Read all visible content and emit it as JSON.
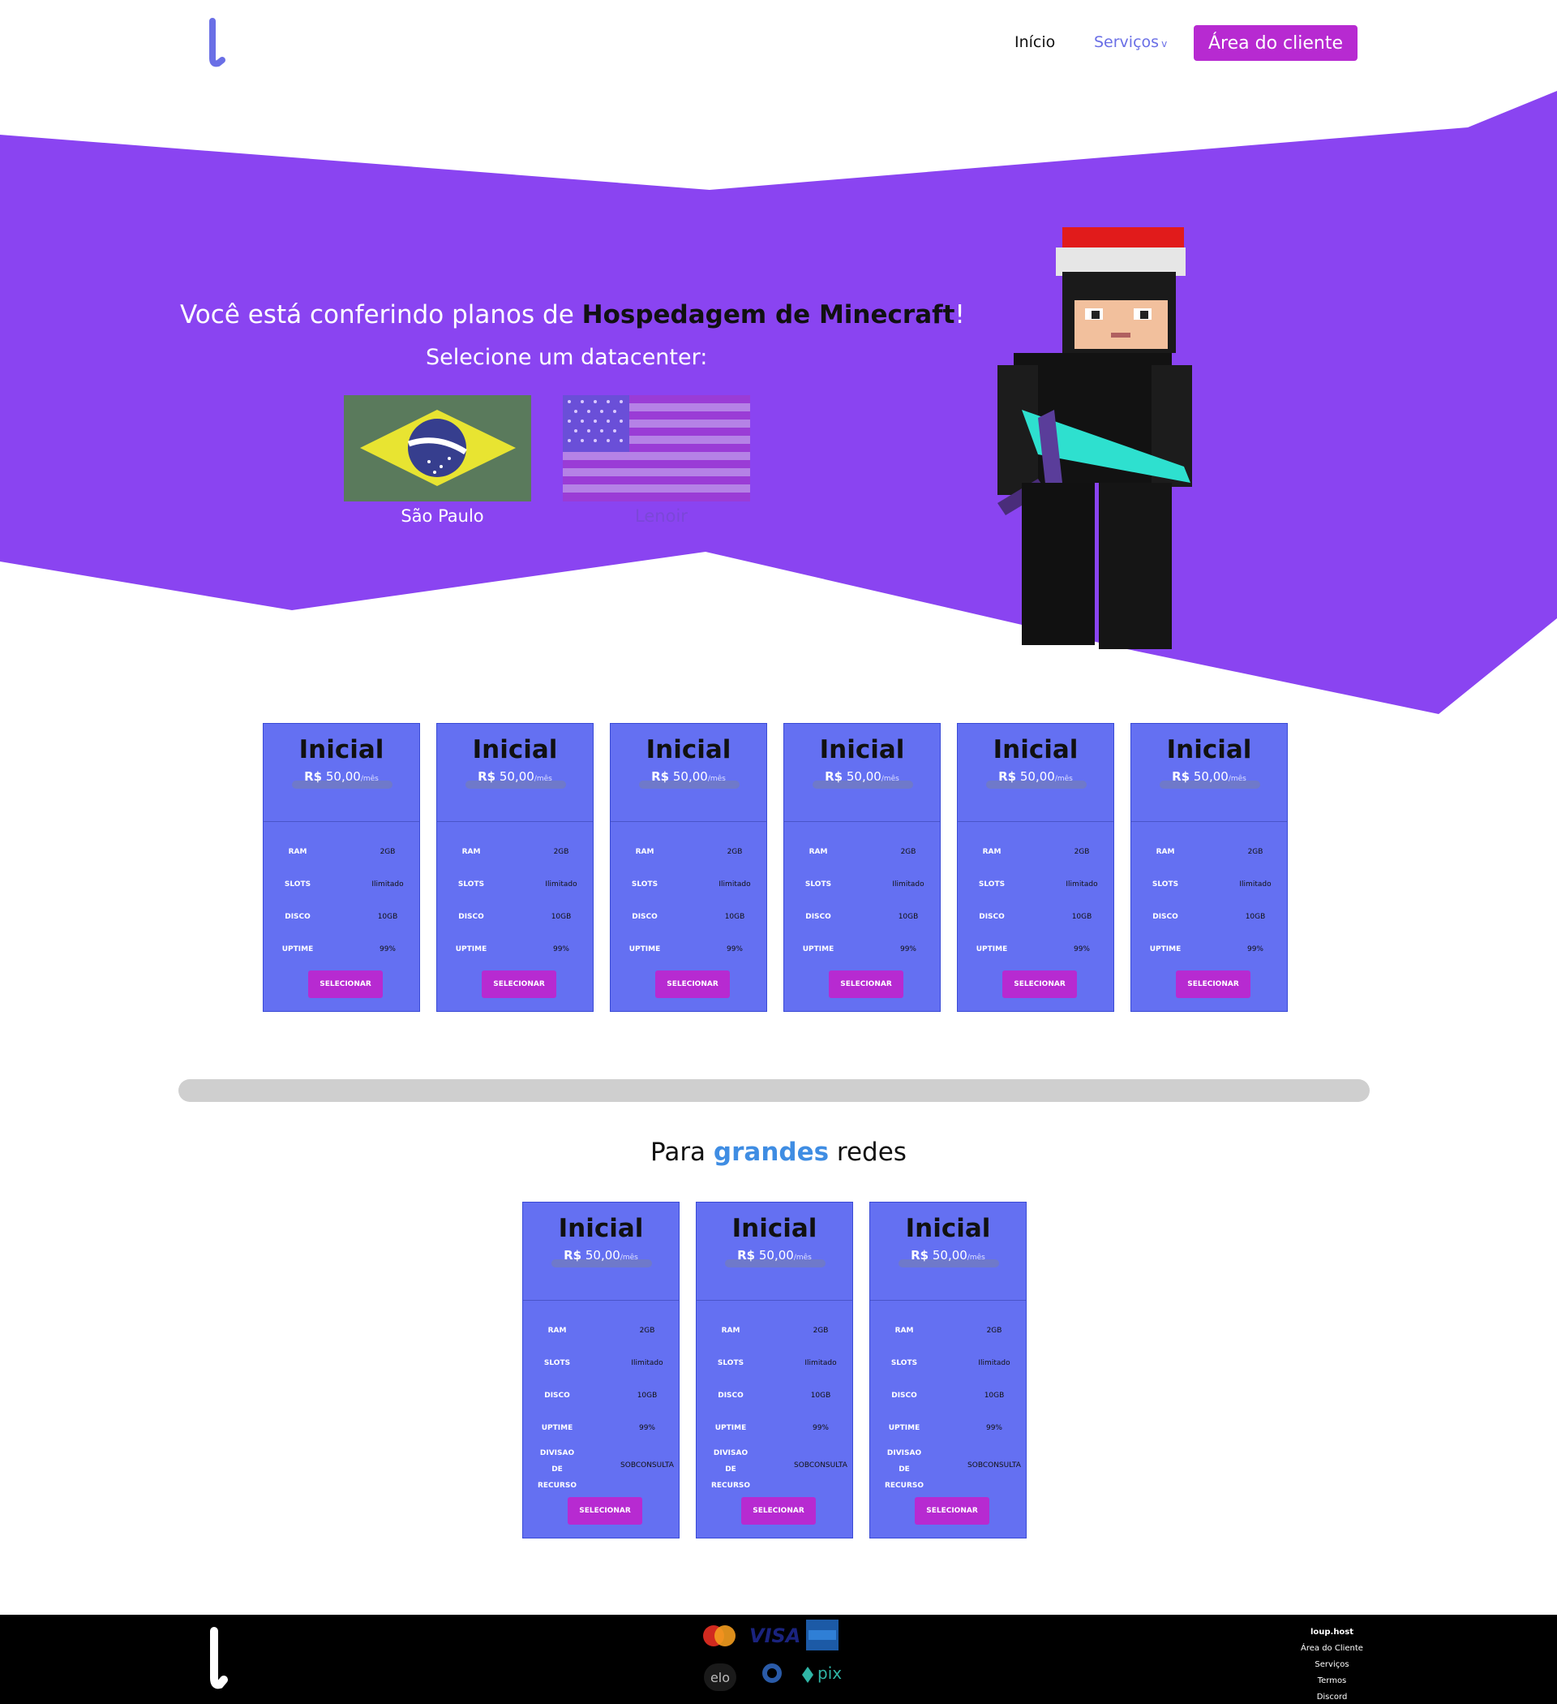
{
  "header": {
    "nav": {
      "inicio": "Início",
      "servicos": "Serviços",
      "caret": "v"
    },
    "client_button": "Área do cliente"
  },
  "hero": {
    "title_prefix": "Você está conferindo planos de ",
    "title_highlight": "Hospedagem de Minecraft",
    "title_suffix": "!",
    "subtitle": "Selecione um datacenter:",
    "datacenters": [
      {
        "label": "São Paulo"
      },
      {
        "label": "Lenoir"
      }
    ],
    "colors": {
      "purple": "#8a44f1",
      "button": "#b72ad1",
      "card": "#6470f2"
    }
  },
  "plans": [
    {
      "title": "Inicial",
      "currency": "R$",
      "price": " 50,00",
      "per": "/mês",
      "specs": [
        [
          "RAM",
          "2GB"
        ],
        [
          "SLOTS",
          "Ilimitado"
        ],
        [
          "DISCO",
          "10GB"
        ],
        [
          "UPTIME",
          "99%"
        ]
      ],
      "button": "SELECIONAR"
    },
    {
      "title": "Inicial",
      "currency": "R$",
      "price": " 50,00",
      "per": "/mês",
      "specs": [
        [
          "RAM",
          "2GB"
        ],
        [
          "SLOTS",
          "Ilimitado"
        ],
        [
          "DISCO",
          "10GB"
        ],
        [
          "UPTIME",
          "99%"
        ]
      ],
      "button": "SELECIONAR"
    },
    {
      "title": "Inicial",
      "currency": "R$",
      "price": " 50,00",
      "per": "/mês",
      "specs": [
        [
          "RAM",
          "2GB"
        ],
        [
          "SLOTS",
          "Ilimitado"
        ],
        [
          "DISCO",
          "10GB"
        ],
        [
          "UPTIME",
          "99%"
        ]
      ],
      "button": "SELECIONAR"
    },
    {
      "title": "Inicial",
      "currency": "R$",
      "price": " 50,00",
      "per": "/mês",
      "specs": [
        [
          "RAM",
          "2GB"
        ],
        [
          "SLOTS",
          "Ilimitado"
        ],
        [
          "DISCO",
          "10GB"
        ],
        [
          "UPTIME",
          "99%"
        ]
      ],
      "button": "SELECIONAR"
    },
    {
      "title": "Inicial",
      "currency": "R$",
      "price": " 50,00",
      "per": "/mês",
      "specs": [
        [
          "RAM",
          "2GB"
        ],
        [
          "SLOTS",
          "Ilimitado"
        ],
        [
          "DISCO",
          "10GB"
        ],
        [
          "UPTIME",
          "99%"
        ]
      ],
      "button": "SELECIONAR"
    },
    {
      "title": "Inicial",
      "currency": "R$",
      "price": " 50,00",
      "per": "/mês",
      "specs": [
        [
          "RAM",
          "2GB"
        ],
        [
          "SLOTS",
          "Ilimitado"
        ],
        [
          "DISCO",
          "10GB"
        ],
        [
          "UPTIME",
          "99%"
        ]
      ],
      "button": "SELECIONAR"
    }
  ],
  "networks": {
    "title_prefix": "Para ",
    "title_highlight": "grandes",
    "title_suffix": " redes",
    "plans": [
      {
        "title": "Inicial",
        "currency": "R$",
        "price": " 50,00",
        "per": "/mês",
        "specs": [
          [
            "RAM",
            "2GB"
          ],
          [
            "SLOTS",
            "Ilimitado"
          ],
          [
            "DISCO",
            "10GB"
          ],
          [
            "UPTIME",
            "99%"
          ],
          [
            "DIVISAO\nDE\nRECURSO",
            "SOBCONSULTA"
          ]
        ],
        "button": "SELECIONAR"
      },
      {
        "title": "Inicial",
        "currency": "R$",
        "price": " 50,00",
        "per": "/mês",
        "specs": [
          [
            "RAM",
            "2GB"
          ],
          [
            "SLOTS",
            "Ilimitado"
          ],
          [
            "DISCO",
            "10GB"
          ],
          [
            "UPTIME",
            "99%"
          ],
          [
            "DIVISAO\nDE\nRECURSO",
            "SOBCONSULTA"
          ]
        ],
        "button": "SELECIONAR"
      },
      {
        "title": "Inicial",
        "currency": "R$",
        "price": " 50,00",
        "per": "/mês",
        "specs": [
          [
            "RAM",
            "2GB"
          ],
          [
            "SLOTS",
            "Ilimitado"
          ],
          [
            "DISCO",
            "10GB"
          ],
          [
            "UPTIME",
            "99%"
          ],
          [
            "DIVISAO\nDE\nRECURSO",
            "SOBCONSULTA"
          ]
        ],
        "button": "SELECIONAR"
      }
    ]
  },
  "footer": {
    "payment_icons": [
      "mastercard-icon",
      "visa-icon",
      "amex-icon",
      "elo-icon",
      "diners-icon",
      "pix-icon"
    ],
    "visa_text": "VISA",
    "elo_text": "elo",
    "pix_text": "pix",
    "brand_name": "loup",
    "brand_suffix": ".host",
    "links": [
      "Área do Cliente",
      "Serviços",
      "Termos",
      "Discord"
    ]
  }
}
